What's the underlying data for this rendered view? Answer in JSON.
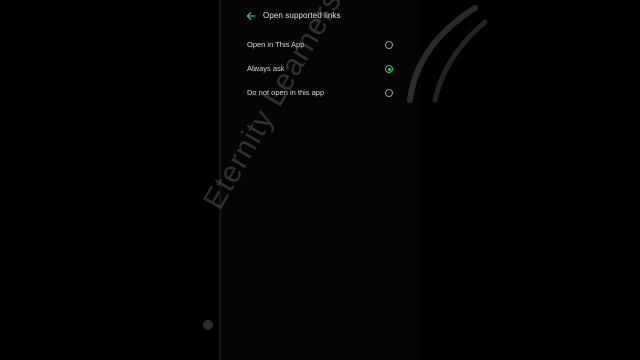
{
  "header": {
    "title": "Open supported links",
    "back_icon": "arrow-left-icon"
  },
  "options": [
    {
      "label": "Open in This App",
      "selected": false
    },
    {
      "label": "Always ask",
      "selected": true
    },
    {
      "label": "Do not open in this app",
      "selected": false
    }
  ],
  "watermark": {
    "text": "Eternity Learners"
  },
  "colors": {
    "accent": "#2ecc71",
    "background": "#000000",
    "text": "#d8d8d8"
  }
}
